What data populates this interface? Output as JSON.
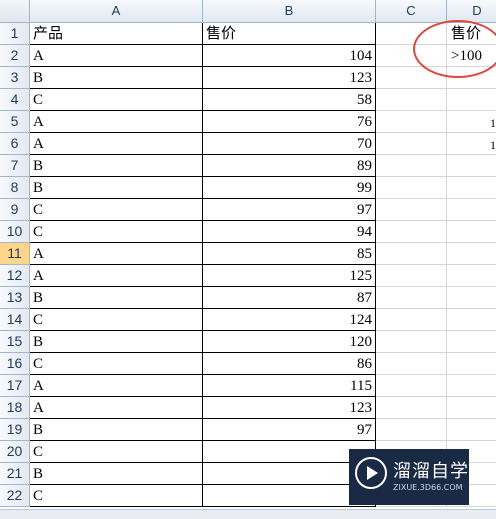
{
  "columns": [
    "A",
    "B",
    "C",
    "D"
  ],
  "rows": [
    "1",
    "2",
    "3",
    "4",
    "5",
    "6",
    "7",
    "8",
    "9",
    "10",
    "11",
    "12",
    "13",
    "14",
    "15",
    "16",
    "17",
    "18",
    "19",
    "20",
    "21",
    "22"
  ],
  "colA": [
    "产品",
    "A",
    "B",
    "C",
    "A",
    "A",
    "B",
    "B",
    "C",
    "C",
    "A",
    "A",
    "B",
    "C",
    "B",
    "C",
    "A",
    "A",
    "B",
    "C",
    "B",
    "C"
  ],
  "colB": [
    "售价",
    "104",
    "123",
    "58",
    "76",
    "70",
    "89",
    "99",
    "97",
    "94",
    "85",
    "125",
    "87",
    "124",
    "120",
    "86",
    "115",
    "123",
    "97",
    "",
    "",
    ""
  ],
  "criteria": {
    "header": "售价",
    "value": ">100"
  },
  "fragments": {
    "row5": "1",
    "row6": "1"
  },
  "active_row": "11",
  "watermark": {
    "name": "溜溜自学",
    "url": "ZIXUE.3D66.COM"
  },
  "colors": {
    "circle": "#e0463a",
    "active_row_header": "#ffd58a",
    "watermark_bg": "#1a2a44"
  }
}
